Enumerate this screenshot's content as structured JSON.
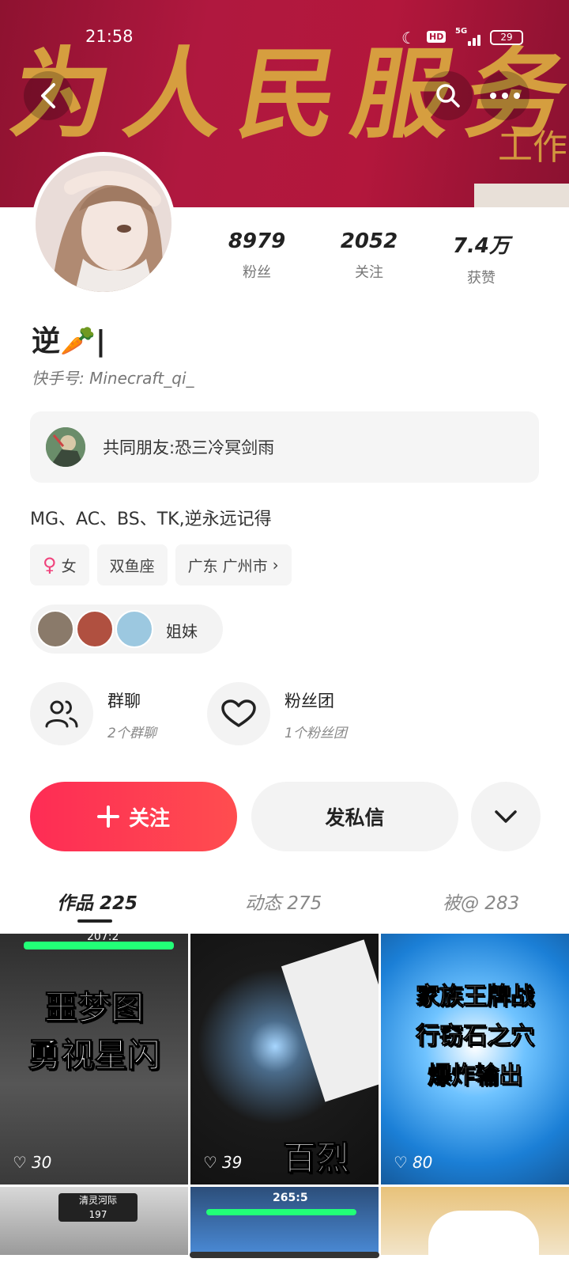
{
  "status_bar": {
    "time": "21:58",
    "hd": "HD",
    "network": "5G",
    "battery": "29"
  },
  "banner": {
    "calligraphy": "为人民服务",
    "calligraphy_small": "工作"
  },
  "stats": [
    {
      "num": "8979",
      "label": "粉丝"
    },
    {
      "num": "2052",
      "label": "关注"
    },
    {
      "num": "7.4万",
      "label": "获赞"
    }
  ],
  "profile": {
    "nickname": "逆🥕|",
    "kuaishou_id": "快手号: Minecraft_qi_"
  },
  "mutual": {
    "text": "共同朋友:恐三冷冥剑雨"
  },
  "bio": "MG、AC、BS、TK,逆永远记得",
  "tags": {
    "gender": "女",
    "zodiac": "双鱼座",
    "location": "广东 广州市"
  },
  "sisters_label": "姐妹",
  "features": {
    "group_chat": {
      "title": "群聊",
      "sub": "2个群聊"
    },
    "fan_club": {
      "title": "粉丝团",
      "sub": "1个粉丝团"
    }
  },
  "actions": {
    "follow": "关注",
    "message": "发私信"
  },
  "tabs": [
    "作品 225",
    "动态 275",
    "被@ 283"
  ],
  "videos": [
    {
      "caption1": "噩梦图",
      "caption2": "勇视星闪",
      "likes": "30",
      "hud": "207:2"
    },
    {
      "caption1": "百烈",
      "caption2": "",
      "likes": "39"
    },
    {
      "caption1": "家族王牌战",
      "caption2": "行窃石之穴",
      "caption3": "爆炸输出",
      "likes": "80"
    },
    {
      "caption1": "清灵河际",
      "caption2": "197",
      "likes": ""
    },
    {
      "caption1": "265:5",
      "caption2": "",
      "likes": ""
    },
    {
      "caption1": "",
      "caption2": "",
      "likes": ""
    }
  ]
}
